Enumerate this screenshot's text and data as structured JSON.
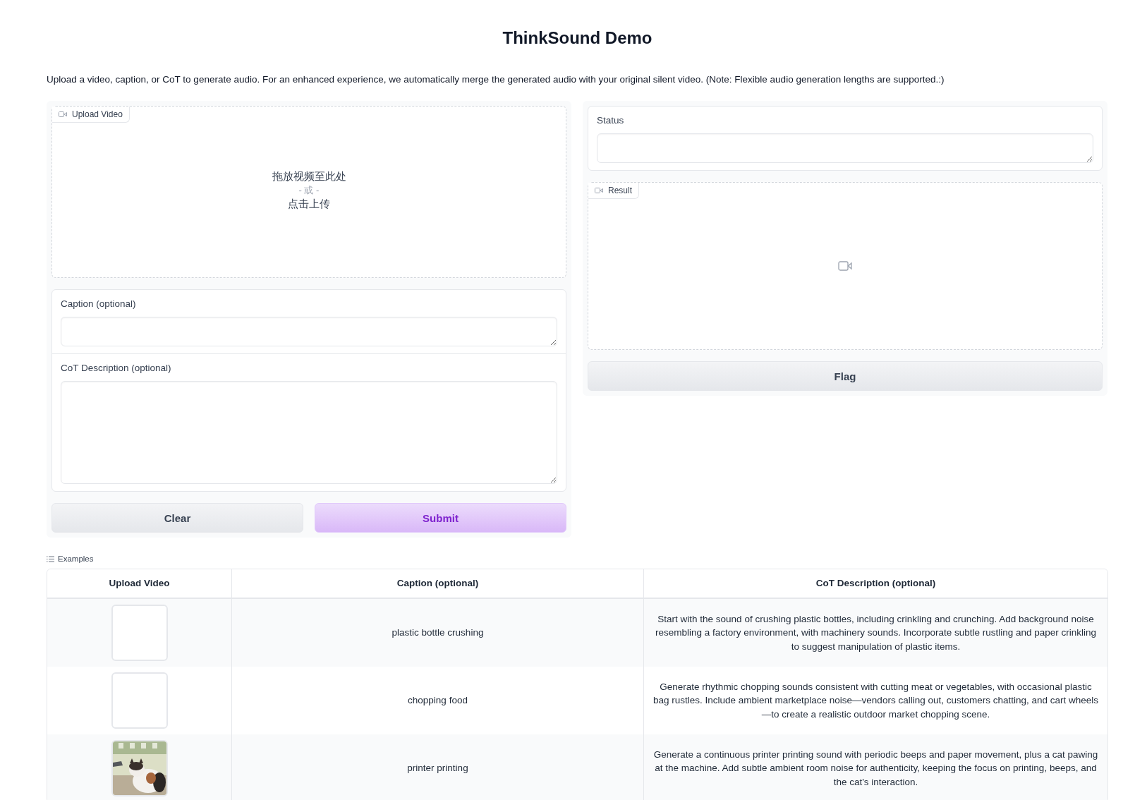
{
  "title": "ThinkSound Demo",
  "description": "Upload a video, caption, or CoT to generate audio. For an enhanced experience, we automatically merge the generated audio with your original silent video. (Note: Flexible audio generation lengths are supported.:)",
  "upload_video": {
    "label": "Upload Video",
    "drop_text": "拖放视频至此处",
    "or_text": "- 或 -",
    "click_text": "点击上传"
  },
  "caption": {
    "label": "Caption (optional)"
  },
  "cot": {
    "label": "CoT Description (optional)"
  },
  "buttons": [
    {
      "label": "Clear",
      "kind": "secondary"
    },
    {
      "label": "Submit",
      "kind": "primary"
    }
  ],
  "status": {
    "label": "Status"
  },
  "result": {
    "label": "Result"
  },
  "flag_button": "Flag",
  "examples": {
    "label": "Examples",
    "columns": [
      "Upload Video",
      "Caption (optional)",
      "CoT Description (optional)"
    ],
    "rows": [
      {
        "kind": "empty",
        "caption": "plastic bottle crushing",
        "cot": "Start with the sound of crushing plastic bottles, including crinkling and crunching. Add background noise resembling a factory environment, with machinery sounds. Incorporate subtle rustling and paper crinkling to suggest manipulation of plastic items."
      },
      {
        "kind": "empty",
        "caption": "chopping food",
        "cot": "Generate rhythmic chopping sounds consistent with cutting meat or vegetables, with occasional plastic bag rustles. Include ambient marketplace noise—vendors calling out, customers chatting, and cart wheels—to create a realistic outdoor market chopping scene."
      },
      {
        "kind": "picture",
        "caption": "printer printing",
        "cot": "Generate a continuous printer printing sound with periodic beeps and paper movement, plus a cat pawing at the machine. Add subtle ambient room noise for authenticity, keeping the focus on printing, beeps, and the cat's interaction."
      }
    ]
  }
}
